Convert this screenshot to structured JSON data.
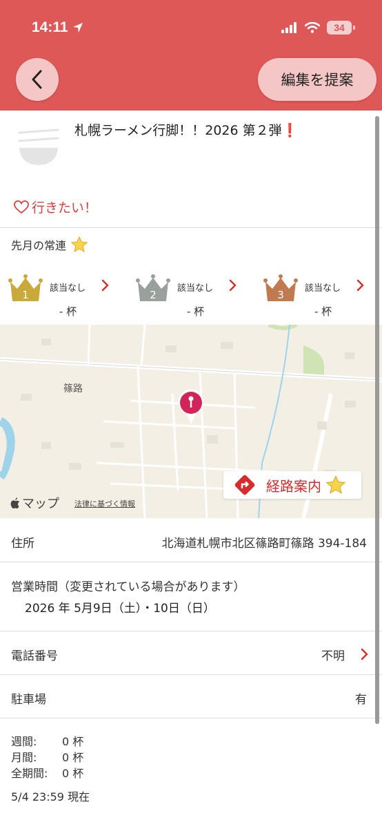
{
  "status_bar": {
    "time": "14:11",
    "battery": "34"
  },
  "header": {
    "edit_label": "編集を提案",
    "bg_color": "#df5858"
  },
  "shop": {
    "title": "札幌ラーメン行脚！！2026 第２弾",
    "title_mark": "❗",
    "want_label": "行きたい！"
  },
  "regulars": {
    "title": "先月の常連",
    "ranks": [
      {
        "rank": "1",
        "name": "該当なし",
        "cups": "- 杯",
        "color": "#c9a93a"
      },
      {
        "rank": "2",
        "name": "該当なし",
        "cups": "- 杯",
        "color": "#9aa09c"
      },
      {
        "rank": "3",
        "name": "該当なし",
        "cups": "- 杯",
        "color": "#c07a50"
      }
    ]
  },
  "map": {
    "place_label": "篠路",
    "logo_text": "マップ",
    "legal_link": "法律に基づく情報",
    "route_label": "経路案内"
  },
  "info": {
    "address_label": "住所",
    "address_value": "北海道札幌市北区篠路町篠路 394-184",
    "hours_label": "営業時間（変更されている場合があります）",
    "hours_value": "2026 年 5月9日（土）・10日（日）",
    "phone_label": "電話番号",
    "phone_value": "不明",
    "parking_label": "駐車場",
    "parking_value": "有"
  },
  "stats": {
    "rows": [
      {
        "label": "週間:",
        "value": "0 杯"
      },
      {
        "label": "月間:",
        "value": "0 杯"
      },
      {
        "label": "全期間:",
        "value": "0 杯"
      }
    ],
    "as_of": "5/4 23:59 現在"
  }
}
